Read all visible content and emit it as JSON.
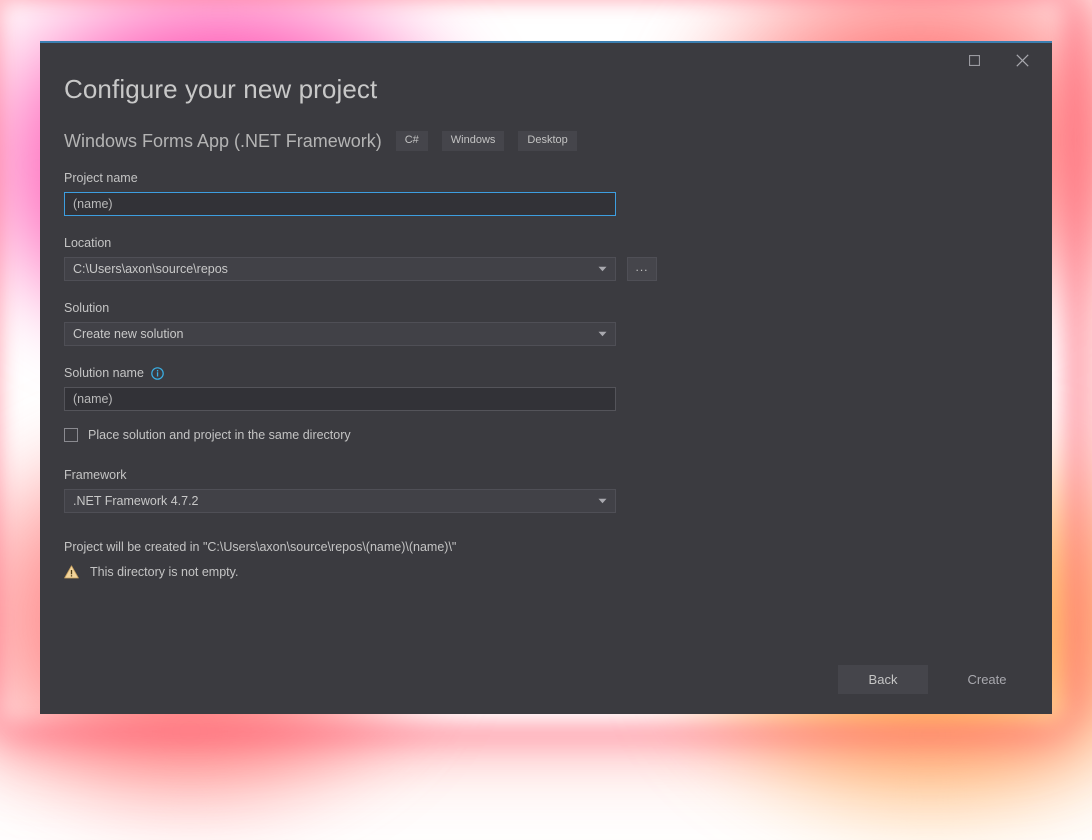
{
  "window": {
    "maximize_icon": "maximize-icon",
    "close_icon": "close-icon"
  },
  "header": {
    "title": "Configure your new project",
    "template_name": "Windows Forms App (.NET Framework)",
    "tags": [
      "C#",
      "Windows",
      "Desktop"
    ]
  },
  "form": {
    "project_name": {
      "label": "Project name",
      "value": "(name)"
    },
    "location": {
      "label": "Location",
      "value": "C:\\Users\\axon\\source\\repos",
      "browse_label": "...",
      "caret_icon": "chevron-down-icon"
    },
    "solution": {
      "label": "Solution",
      "value": "Create new solution",
      "caret_icon": "chevron-down-icon"
    },
    "solution_name": {
      "label": "Solution name",
      "value": "(name)",
      "info_icon": "info-icon"
    },
    "same_directory": {
      "label": "Place solution and project in the same directory",
      "checked": false
    },
    "framework": {
      "label": "Framework",
      "value": ".NET Framework 4.7.2",
      "caret_icon": "chevron-down-icon"
    },
    "created_path": "Project will be created in \"C:\\Users\\axon\\source\\repos\\(name)\\(name)\\\"",
    "warning": {
      "icon": "warning-triangle-icon",
      "text": "This directory is not empty."
    }
  },
  "footer": {
    "back_label": "Back",
    "create_label": "Create"
  },
  "colors": {
    "dialog_background": "#3b3b40",
    "focus_border": "#3d9ee0",
    "info_icon": "#3ab0e6",
    "warning_icon": "#f2d49b",
    "glow_pink": "#ff008c",
    "glow_red": "#ff3e3e",
    "glow_orange": "#ff8e18"
  }
}
